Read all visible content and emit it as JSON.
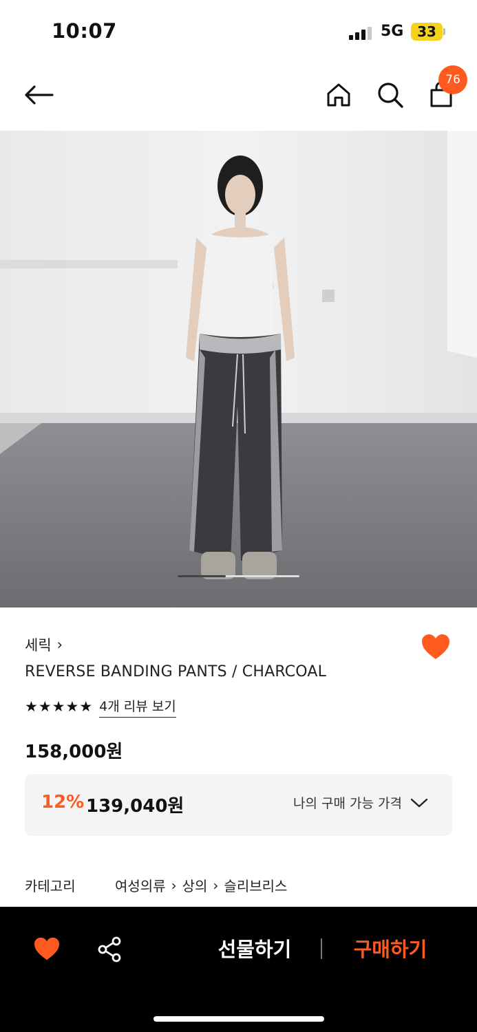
{
  "status_bar": {
    "time": "10:07",
    "network": "5G",
    "battery": "33"
  },
  "nav": {
    "back_icon": "arrow-left-icon",
    "home_icon": "home-icon",
    "search_icon": "search-icon",
    "bag_icon": "shopping-bag-icon",
    "cart_count": "76"
  },
  "product": {
    "image_alt": "model wearing charcoal banding pants",
    "brand": "세릭",
    "brand_chevron": "›",
    "name": "REVERSE BANDING PANTS / CHARCOAL",
    "rating_stars": 5,
    "review_link": "4개 리뷰 보기",
    "original_price": "158,000원",
    "discount_rate": "12%",
    "discount_price": "139,040원",
    "my_price_label": "나의 구매 가능 가격",
    "category_label": "카테고리",
    "category_path": [
      "여성의류",
      "상의",
      "슬리브리스"
    ]
  },
  "bottom_bar": {
    "gift_label": "선물하기",
    "buy_label": "구매하기"
  },
  "colors": {
    "accent": "#ff5a1f",
    "bar_bg": "#000000",
    "box_bg": "#f4f4f4"
  }
}
